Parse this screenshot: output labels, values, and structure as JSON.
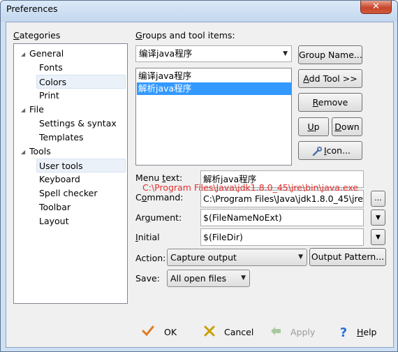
{
  "window": {
    "title": "Preferences",
    "close_glyph": "✕"
  },
  "categories": {
    "label_prefix": "",
    "label_accel": "C",
    "label_rest": "ategories",
    "tree": [
      {
        "label": "General",
        "level": 0,
        "expanded": true
      },
      {
        "label": "Fonts",
        "level": 1
      },
      {
        "label": "Colors",
        "level": 1
      },
      {
        "label": "Print",
        "level": 1
      },
      {
        "label": "File",
        "level": 0,
        "expanded": true
      },
      {
        "label": "Settings & syntax",
        "level": 1
      },
      {
        "label": "Templates",
        "level": 1
      },
      {
        "label": "Tools",
        "level": 0,
        "expanded": true
      },
      {
        "label": "User tools",
        "level": 1
      },
      {
        "label": "Keyboard",
        "level": 1
      },
      {
        "label": "Spell checker",
        "level": 1
      },
      {
        "label": "Toolbar",
        "level": 1
      },
      {
        "label": "Layout",
        "level": 1
      }
    ]
  },
  "groups": {
    "label_accel": "G",
    "label_rest": "roups and tool items:",
    "selected_group": "编译java程序",
    "items": [
      "编译java程序",
      "解析java程序"
    ],
    "selected_index": 1
  },
  "buttons": {
    "group_name": {
      "accel": "",
      "text": "Group Name..."
    },
    "add_tool": {
      "accel": "A",
      "text": "dd Tool >>"
    },
    "remove": {
      "accel": "R",
      "text": "emove"
    },
    "up": {
      "accel": "U",
      "text": "p"
    },
    "down": {
      "accel": "D",
      "text": "own"
    },
    "icon": {
      "accel": "I",
      "text": "con..."
    }
  },
  "form": {
    "menu_text": {
      "label_pre": "Menu ",
      "label_accel": "t",
      "label_post": "ext:",
      "value": "解析java程序"
    },
    "command": {
      "label_pre": "C",
      "label_accel": "o",
      "label_post": "mmand:",
      "value": "C:\\Program Files\\Java\\jdk1.8.0_45\\jre\\b",
      "overlay": "C:\\Program Files\\Java\\jdk1.8.0_45\\jre\\bin\\java.exe",
      "overlay_color": "#e03030"
    },
    "argument": {
      "label_pre": "Ar",
      "label_accel": "g",
      "label_post": "ument:",
      "value": "$(FileNameNoExt)"
    },
    "initial": {
      "label_pre": "",
      "label_accel": "I",
      "label_post": "nitial",
      "value": "$(FileDir)"
    },
    "action": {
      "label": "Action:",
      "value": "Capture output",
      "output_pattern": "Output Pattern..."
    },
    "save": {
      "label": "Save:",
      "value": "All open files"
    }
  },
  "footer": {
    "ok": "OK",
    "cancel": "Cancel",
    "apply": "Apply",
    "help": "Help",
    "colors": {
      "ok": "#e07a20",
      "cancel": "#c8a000",
      "apply": "#a8c8a0",
      "help": "#2a6fd6"
    }
  }
}
